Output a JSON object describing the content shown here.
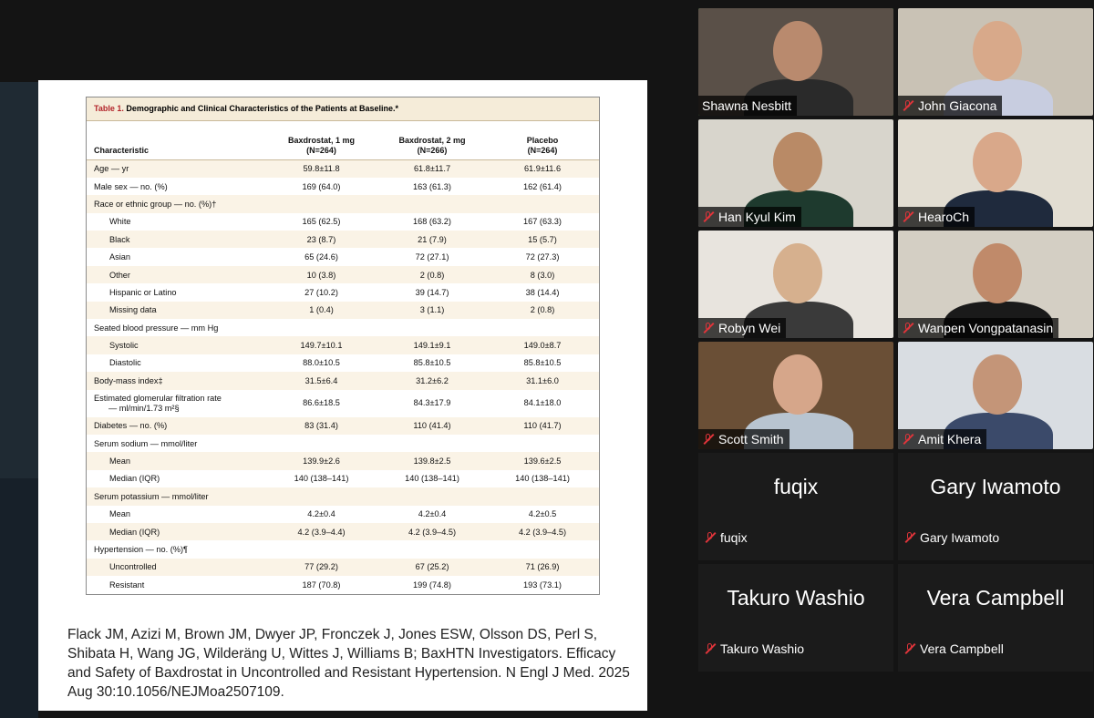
{
  "table": {
    "label": "Table 1.",
    "title": "Demographic and Clinical Characteristics of the Patients at Baseline.*",
    "columns": [
      {
        "name": "Characteristic"
      },
      {
        "name": "Baxdrostat, 1 mg",
        "n": "(N=264)"
      },
      {
        "name": "Baxdrostat, 2 mg",
        "n": "(N=266)"
      },
      {
        "name": "Placebo",
        "n": "(N=264)"
      }
    ],
    "rows": [
      {
        "label": "Age — yr",
        "indent": false,
        "values": [
          "59.8±11.8",
          "61.8±11.7",
          "61.9±11.6"
        ]
      },
      {
        "label": "Male sex — no. (%)",
        "indent": false,
        "values": [
          "169 (64.0)",
          "163 (61.3)",
          "162 (61.4)"
        ]
      },
      {
        "label": "Race or ethnic group — no. (%)†",
        "indent": false,
        "values": [
          "",
          "",
          ""
        ]
      },
      {
        "label": "White",
        "indent": true,
        "values": [
          "165 (62.5)",
          "168 (63.2)",
          "167 (63.3)"
        ]
      },
      {
        "label": "Black",
        "indent": true,
        "values": [
          "23 (8.7)",
          "21 (7.9)",
          "15 (5.7)"
        ]
      },
      {
        "label": "Asian",
        "indent": true,
        "values": [
          "65 (24.6)",
          "72 (27.1)",
          "72 (27.3)"
        ]
      },
      {
        "label": "Other",
        "indent": true,
        "values": [
          "10 (3.8)",
          "2 (0.8)",
          "8 (3.0)"
        ]
      },
      {
        "label": "Hispanic or Latino",
        "indent": true,
        "values": [
          "27 (10.2)",
          "39 (14.7)",
          "38 (14.4)"
        ]
      },
      {
        "label": "Missing data",
        "indent": true,
        "values": [
          "1 (0.4)",
          "3 (1.1)",
          "2 (0.8)"
        ]
      },
      {
        "label": "Seated blood pressure — mm Hg",
        "indent": false,
        "values": [
          "",
          "",
          ""
        ]
      },
      {
        "label": "Systolic",
        "indent": true,
        "values": [
          "149.7±10.1",
          "149.1±9.1",
          "149.0±8.7"
        ]
      },
      {
        "label": "Diastolic",
        "indent": true,
        "values": [
          "88.0±10.5",
          "85.8±10.5",
          "85.8±10.5"
        ]
      },
      {
        "label": "Body-mass index‡",
        "indent": false,
        "values": [
          "31.5±6.4",
          "31.2±6.2",
          "31.1±6.0"
        ]
      },
      {
        "label": "Estimated glomerular filtration rate",
        "label2": "— ml/min/1.73 m²§",
        "indent": false,
        "values": [
          "86.6±18.5",
          "84.3±17.9",
          "84.1±18.0"
        ]
      },
      {
        "label": "Diabetes — no. (%)",
        "indent": false,
        "values": [
          "83 (31.4)",
          "110 (41.4)",
          "110 (41.7)"
        ]
      },
      {
        "label": "Serum sodium — mmol/liter",
        "indent": false,
        "values": [
          "",
          "",
          ""
        ]
      },
      {
        "label": "Mean",
        "indent": true,
        "values": [
          "139.9±2.6",
          "139.8±2.5",
          "139.6±2.5"
        ]
      },
      {
        "label": "Median (IQR)",
        "indent": true,
        "values": [
          "140 (138–141)",
          "140 (138–141)",
          "140 (138–141)"
        ]
      },
      {
        "label": "Serum potassium — mmol/liter",
        "indent": false,
        "values": [
          "",
          "",
          ""
        ]
      },
      {
        "label": "Mean",
        "indent": true,
        "values": [
          "4.2±0.4",
          "4.2±0.4",
          "4.2±0.5"
        ]
      },
      {
        "label": "Median (IQR)",
        "indent": true,
        "values": [
          "4.2 (3.9–4.4)",
          "4.2 (3.9–4.5)",
          "4.2 (3.9–4.5)"
        ]
      },
      {
        "label": "Hypertension — no. (%)¶",
        "indent": false,
        "values": [
          "",
          "",
          ""
        ]
      },
      {
        "label": "Uncontrolled",
        "indent": true,
        "values": [
          "77 (29.2)",
          "67 (25.2)",
          "71 (26.9)"
        ]
      },
      {
        "label": "Resistant",
        "indent": true,
        "values": [
          "187 (70.8)",
          "199 (74.8)",
          "193 (73.1)"
        ]
      }
    ]
  },
  "citation": "Flack JM, Azizi M, Brown JM, Dwyer JP, Fronczek J, Jones ESW, Olsson DS, Perl S, Shibata H, Wang JG, Wilderäng U, Wittes J, Williams B; BaxHTN Investigators. Efficacy and Safety of Baxdrostat in Uncontrolled and Resistant Hypertension. N Engl J Med. 2025 Aug 30:10.1056/NEJMoa2507109.",
  "participants_video": [
    {
      "name": "Shawna Nesbitt",
      "muted": false,
      "active": true,
      "bg": "#5a5048",
      "skin": "#b98a6e",
      "shirt": "#2a2a2a"
    },
    {
      "name": "John Giacona",
      "muted": true,
      "active": false,
      "bg": "#c9c2b5",
      "skin": "#d8a98a",
      "shirt": "#c8cde0"
    },
    {
      "name": "Han Kyul Kim",
      "muted": true,
      "active": false,
      "bg": "#d8d5cc",
      "skin": "#b98a66",
      "shirt": "#1e3a2e"
    },
    {
      "name": "HearoCh",
      "muted": true,
      "active": false,
      "bg": "#e2ddd2",
      "skin": "#d9a88a",
      "shirt": "#1f2a3d"
    },
    {
      "name": "Robyn Wei",
      "muted": true,
      "active": false,
      "bg": "#e8e4de",
      "skin": "#d6b08e",
      "shirt": "#3a3a3a"
    },
    {
      "name": "Wanpen Vongpatanasin",
      "muted": true,
      "active": false,
      "bg": "#d4cfc4",
      "skin": "#c08a6a",
      "shirt": "#1a1a1a"
    },
    {
      "name": "Scott Smith",
      "muted": true,
      "active": false,
      "bg": "#6a4f36",
      "skin": "#d6a68a",
      "shirt": "#b8c4d0"
    },
    {
      "name": "Amit Khera",
      "muted": true,
      "active": false,
      "bg": "#d9dde2",
      "skin": "#c49578",
      "shirt": "#3b4a6a"
    }
  ],
  "participants_placeholder": [
    {
      "name": "fuqix",
      "muted": true
    },
    {
      "name": "Gary Iwamoto",
      "muted": true
    },
    {
      "name": "Takuro Washio",
      "muted": true
    },
    {
      "name": "Vera Campbell",
      "muted": true
    }
  ]
}
